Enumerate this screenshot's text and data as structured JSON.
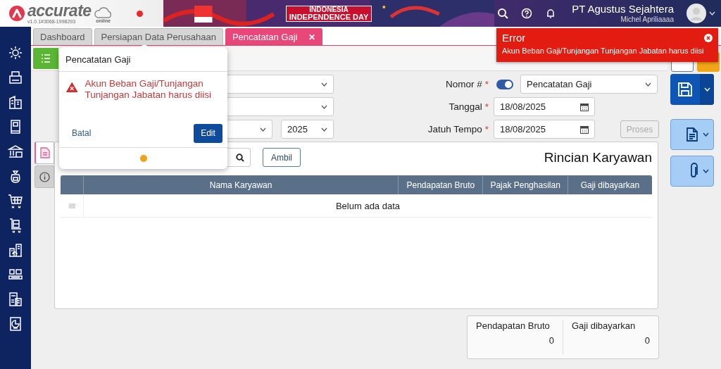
{
  "header": {
    "logo_text": "accurate",
    "logo_sub": "online",
    "version": "v1.0.1#3068-1998293",
    "banner_lines": [
      "INDONESIA",
      "INDEPENDENCE DAY"
    ],
    "company": "PT Agustus Sejahtera",
    "user": "Michel Apriliaaaa"
  },
  "tabs": [
    {
      "label": "Dashboard",
      "selected": false,
      "closable": false
    },
    {
      "label": "Persiapan Data Perusahaan",
      "selected": false,
      "closable": false
    },
    {
      "label": "Pencatatan Gaji",
      "selected": true,
      "closable": true
    }
  ],
  "close_glyph": "✕",
  "left_fields": [
    {
      "kind": "select"
    },
    {
      "kind": "select"
    }
  ],
  "period": [
    {
      "kind": "month"
    },
    {
      "kind": "year",
      "value": "2025"
    }
  ],
  "right_fields": [
    {
      "label": "Nomor #",
      "required": true,
      "kind": "number",
      "toggle_on": true,
      "value": "Pencatatan Gaji"
    },
    {
      "label": "Tanggal",
      "required": true,
      "kind": "date",
      "value": "18/08/2025"
    },
    {
      "label": "Jatuh Tempo",
      "required": true,
      "kind": "date",
      "value": "18/08/2025"
    }
  ],
  "required_mark": "*",
  "process_button": {
    "label": "Proses",
    "disabled": true
  },
  "side_tabs": [
    {
      "kind": "document",
      "selected": true
    },
    {
      "kind": "info",
      "selected": false
    }
  ],
  "table": {
    "title": "Rincian Karyawan",
    "fetch_button": "Ambil",
    "columns": [
      "Nama Karyawan",
      "Pendapatan Bruto",
      "Pajak Penghasilan",
      "Gaji dibayarkan"
    ],
    "empty_text": "Belum ada data"
  },
  "totals": [
    {
      "label": "Pendapatan Bruto",
      "value": "0"
    },
    {
      "label": "Gaji dibayarkan",
      "value": "0"
    }
  ],
  "popup": {
    "title": "Pencatatan Gaji",
    "message": "Akun Beban Gaji/Tunjangan Tunjangan Jabatan harus diisi",
    "cancel": "Batal",
    "confirm": "Edit"
  },
  "toast": {
    "title": "Error",
    "message": "Akun Beban Gaji/Tunjangan Tunjangan Jabatan harus diisi"
  }
}
